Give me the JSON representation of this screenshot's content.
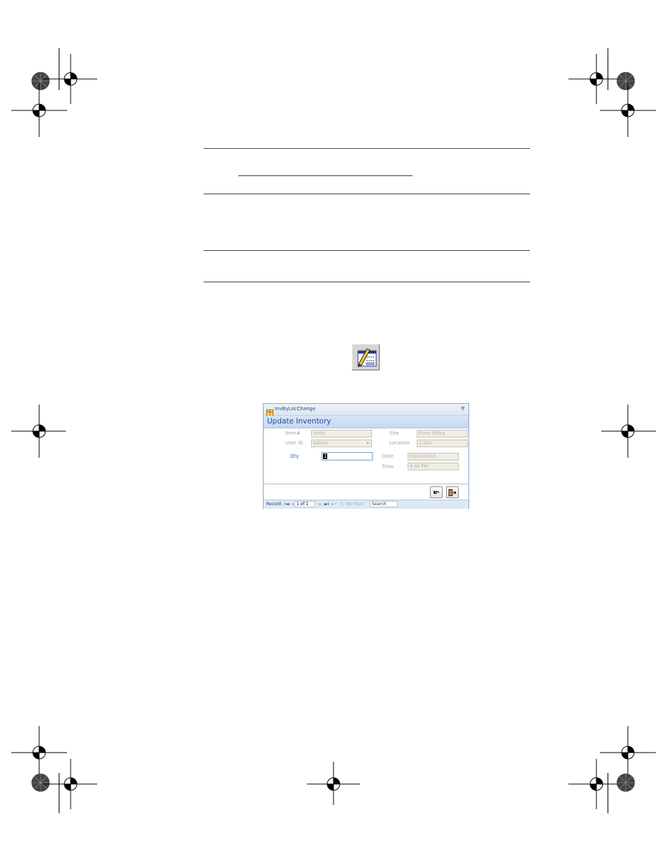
{
  "form": {
    "title": "InvByLocChange",
    "close_glyph": "▼",
    "header": "Update Inventory",
    "fields": {
      "item_label": "Item#",
      "item_value": "1000",
      "userid_label": "User ID",
      "userid_value": "Admin",
      "qty_label": "Qty",
      "qty_value": "1",
      "site_label": "Site",
      "site_value": "Front Office",
      "location_label": "Location",
      "location_value": "2-201",
      "date_label": "Date",
      "date_value": "03/31/2010",
      "time_label": "Time",
      "time_value": "4:02 PM"
    },
    "buttons": [
      "undo-icon",
      "exit-icon"
    ],
    "navbar": {
      "record_label": "Record:",
      "first_glyph": "I◄",
      "prev_glyph": "◄",
      "record_value": "1 of 1",
      "next_glyph": "►",
      "last_glyph": "►I",
      "new_glyph": "►*",
      "filter_label": "No Filter",
      "search_label": "Search"
    }
  },
  "toolbar_icon": "edit-form-icon",
  "colors": {
    "accent": "#1f4e9b",
    "window_border": "#8aa6c9",
    "header_band": "#d7e4f6"
  }
}
